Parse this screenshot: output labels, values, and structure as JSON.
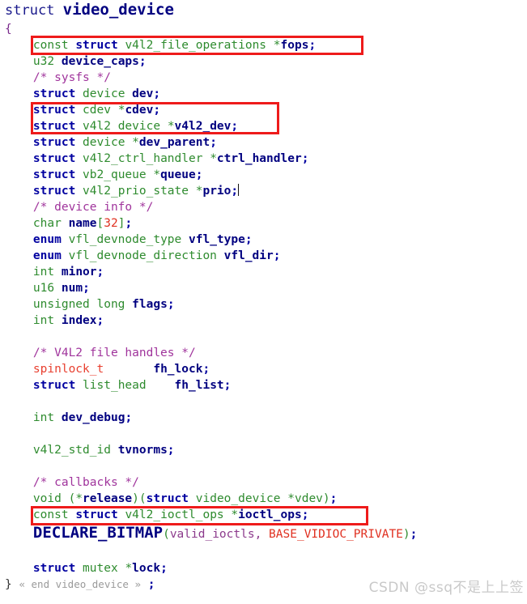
{
  "document": {
    "language": "C",
    "struct_name": "video_device",
    "title": {
      "keyword": "struct ",
      "name": "video_device"
    },
    "open_brace": "{",
    "close_brace": "}",
    "fold_marker": "« end video_device »",
    "close_semicolon": ";"
  },
  "lines": {
    "fops": {
      "const": "const",
      "kw": "struct",
      "type": "v4l2_file_operations",
      "star": "*",
      "ident": "fops",
      "semi": ";"
    },
    "device_caps": {
      "type": "u32",
      "ident": "device_caps",
      "semi": ";"
    },
    "sysfs_cmt": {
      "text": "/* sysfs */"
    },
    "dev": {
      "kw": "struct",
      "type": "device",
      "ident": "dev",
      "semi": ";"
    },
    "cdev": {
      "kw": "struct",
      "type": "cdev",
      "star": "*",
      "ident": "cdev",
      "semi": ";"
    },
    "v4l2_dev": {
      "kw": "struct",
      "type": "v4l2_device",
      "star": "*",
      "ident": "v4l2_dev",
      "semi": ";"
    },
    "dev_parent": {
      "kw": "struct",
      "type": "device",
      "star": "*",
      "ident": "dev_parent",
      "semi": ";"
    },
    "ctrl_handler": {
      "kw": "struct",
      "type": "v4l2_ctrl_handler",
      "star": "*",
      "ident": "ctrl_handler",
      "semi": ";"
    },
    "queue": {
      "kw": "struct",
      "type": "vb2_queue",
      "star": "*",
      "ident": "queue",
      "semi": ";"
    },
    "prio": {
      "kw": "struct",
      "type": "v4l2_prio_state",
      "star": "*",
      "ident": "prio",
      "semi": ";"
    },
    "devinfo_cmt": {
      "text": "/* device info */"
    },
    "name": {
      "type": "char",
      "ident": "name",
      "lbrack": "[",
      "size": "32",
      "rbrack": "]",
      "semi": ";"
    },
    "vfl_type": {
      "kw": "enum",
      "type": "vfl_devnode_type",
      "ident": "vfl_type",
      "semi": ";"
    },
    "vfl_dir": {
      "kw": "enum",
      "type": "vfl_devnode_direction",
      "ident": "vfl_dir",
      "semi": ";"
    },
    "minor": {
      "type": "int",
      "ident": "minor",
      "semi": ";"
    },
    "num": {
      "type": "u16",
      "ident": "num",
      "semi": ";"
    },
    "flags": {
      "type": "unsigned long",
      "ident": "flags",
      "semi": ";"
    },
    "index": {
      "type": "int",
      "ident": "index",
      "semi": ";"
    },
    "fh_cmt": {
      "text": "/* V4L2 file handles */"
    },
    "fh_lock": {
      "type": "spinlock_t",
      "pad": "       ",
      "ident": "fh_lock",
      "semi": ";"
    },
    "fh_list": {
      "kw": "struct",
      "type": "list_head",
      "pad": "    ",
      "ident": "fh_list",
      "semi": ";"
    },
    "dev_debug": {
      "type": "int",
      "ident": "dev_debug",
      "semi": ";"
    },
    "tvnorms": {
      "type": "v4l2_std_id",
      "ident": "tvnorms",
      "semi": ";"
    },
    "callbacks_cmt": {
      "text": "/* callbacks */"
    },
    "release": {
      "type": "void",
      "lparen1": "(",
      "star1": "*",
      "ident": "release",
      "rparen1": ")",
      "lparen2": "(",
      "kw": "struct",
      "type2": "video_device",
      "star2": "*",
      "param": "vdev",
      "rparen2": ")",
      "semi": ";"
    },
    "ioctl_ops": {
      "const": "const",
      "kw": "struct",
      "type": "v4l2_ioctl_ops",
      "star": "*",
      "ident": "ioctl_ops",
      "semi": ";"
    },
    "declare_bitmap": {
      "macro": "DECLARE_BITMAP",
      "lparen": "(",
      "arg1": "valid_ioctls",
      "comma": ", ",
      "arg2": "BASE_VIDIOC_PRIVATE",
      "rparen": ")",
      "semi": ";"
    },
    "lock": {
      "kw": "struct",
      "type": "mutex",
      "star": "*",
      "ident": "lock",
      "semi": ";"
    }
  },
  "annotations": {
    "highlight_color": "#ee1b1b",
    "boxes": [
      {
        "name": "fops-highlight",
        "target": "fops"
      },
      {
        "name": "cdev-v4l2dev-highlight",
        "target": "cdev, v4l2_dev"
      },
      {
        "name": "ioctl-ops-highlight",
        "target": "ioctl_ops"
      }
    ]
  },
  "watermark": {
    "text": "CSDN @ssq不是上上签"
  },
  "palette": {
    "keyword": "#0000a0",
    "type": "#2e8b2e",
    "identifier": "#000080",
    "comment": "#a0349c",
    "number": "#e03020",
    "macro_constant": "#e03020",
    "brace": "#7a2a8c",
    "special_type": "#e84030",
    "fold_marker": "#9a9a9a",
    "background": "#ffffff"
  }
}
